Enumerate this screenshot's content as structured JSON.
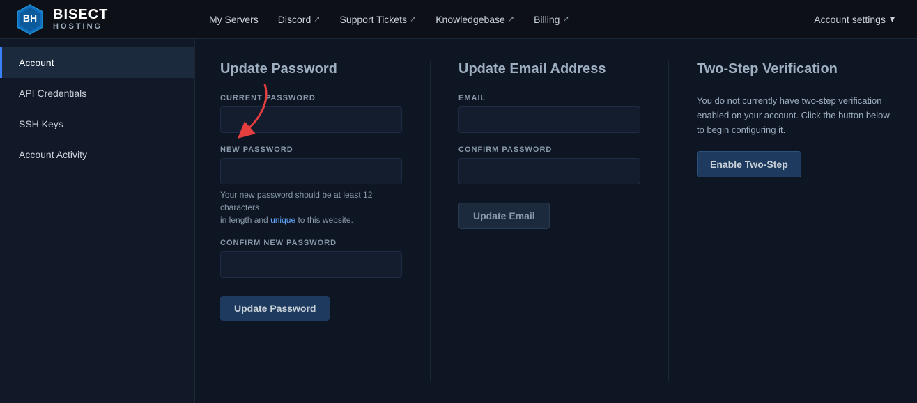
{
  "topnav": {
    "logo": {
      "bisect": "BISECT",
      "hosting": "HOSTING"
    },
    "nav_links": [
      {
        "label": "My Servers",
        "external": false
      },
      {
        "label": "Discord",
        "external": true
      },
      {
        "label": "Support Tickets",
        "external": true
      },
      {
        "label": "Knowledgebase",
        "external": true
      },
      {
        "label": "Billing",
        "external": true
      }
    ],
    "account_settings_label": "Account settings"
  },
  "sidebar": {
    "items": [
      {
        "label": "Account",
        "active": true
      },
      {
        "label": "API Credentials",
        "active": false
      },
      {
        "label": "SSH Keys",
        "active": false
      },
      {
        "label": "Account Activity",
        "active": false
      }
    ]
  },
  "update_password": {
    "title": "Update Password",
    "current_password_label": "CURRENT PASSWORD",
    "new_password_label": "NEW PASSWORD",
    "new_password_hint_1": "Your new password should be at least 12 characters",
    "new_password_hint_2": "in length and",
    "new_password_hint_3": "unique",
    "new_password_hint_4": "to this website.",
    "confirm_new_password_label": "CONFIRM NEW PASSWORD",
    "submit_label": "Update Password"
  },
  "update_email": {
    "title": "Update Email Address",
    "email_label": "EMAIL",
    "confirm_password_label": "CONFIRM PASSWORD",
    "submit_label": "Update Email"
  },
  "two_step": {
    "title": "Two-Step Verification",
    "description": "You do not currently have two-step verification enabled on your account. Click the button below to begin configuring it.",
    "enable_label": "Enable Two-Step"
  }
}
